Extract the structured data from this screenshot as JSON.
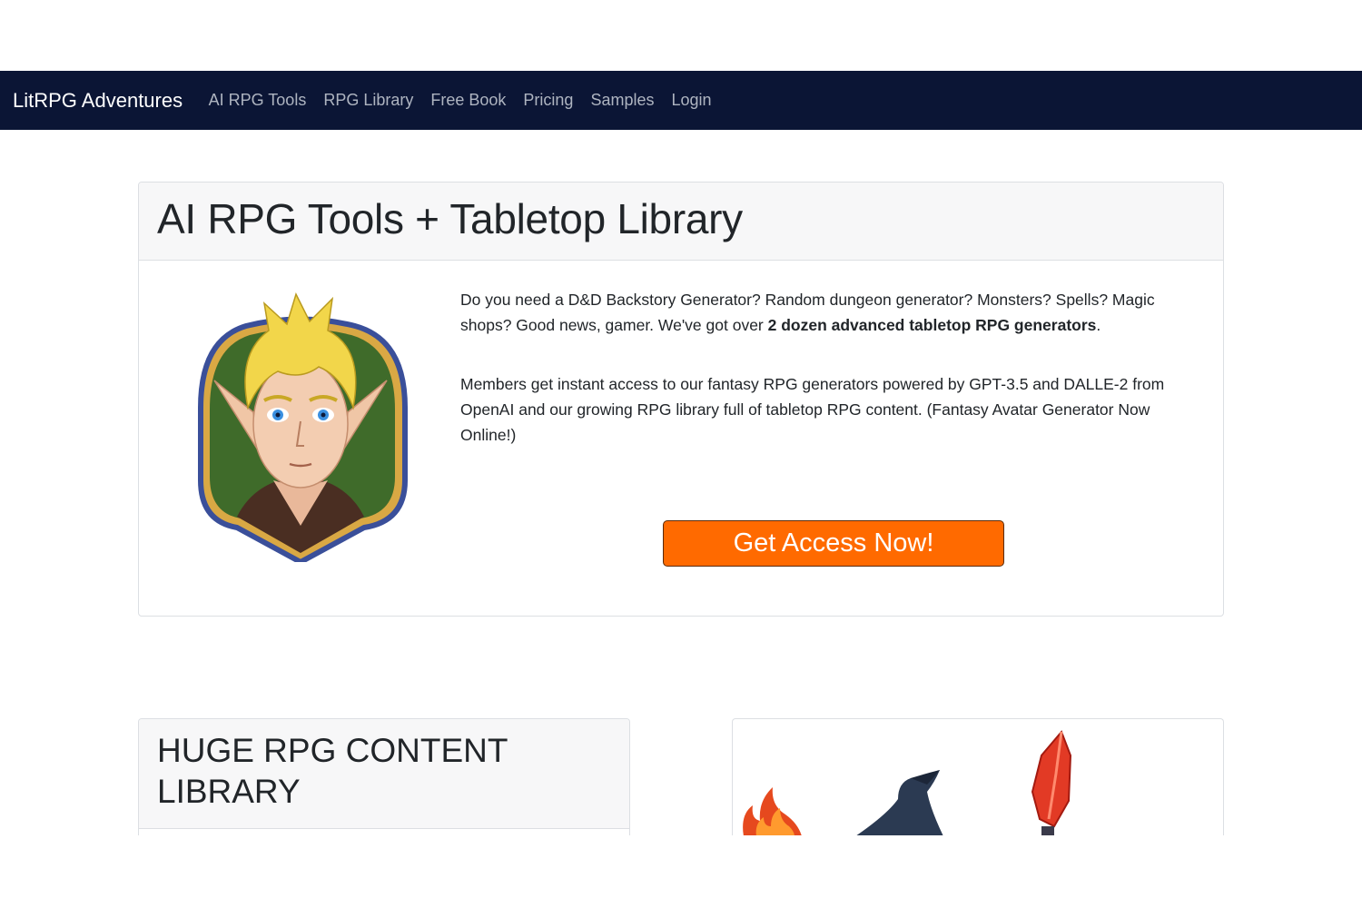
{
  "navbar": {
    "brand": "LitRPG Adventures",
    "links": [
      "AI RPG Tools",
      "RPG Library",
      "Free Book",
      "Pricing",
      "Samples",
      "Login"
    ]
  },
  "hero": {
    "title": "AI RPG Tools + Tabletop Library",
    "p1_text": "Do you need a D&D Backstory Generator? Random dungeon generator? Monsters? Spells? Magic shops? Good news, gamer. We've got over ",
    "p1_bold": "2 dozen advanced tabletop RPG generators",
    "p1_end": ".",
    "p2": "Members get instant access to our fantasy RPG generators powered by GPT-3.5 and DALLE-2 from OpenAI and our growing RPG library full of tabletop RPG content. (Fantasy Avatar Generator Now Online!)",
    "cta_label": "Get Access Now!"
  },
  "library": {
    "title": "HUGE RPG CONTENT LIBRARY"
  },
  "colors": {
    "navbar_bg": "#0b1535",
    "cta_bg": "#ff6a00"
  },
  "icons": [
    "elf-avatar-portrait",
    "flame-icon",
    "wizard-hat-icon",
    "red-crystal-icon"
  ]
}
